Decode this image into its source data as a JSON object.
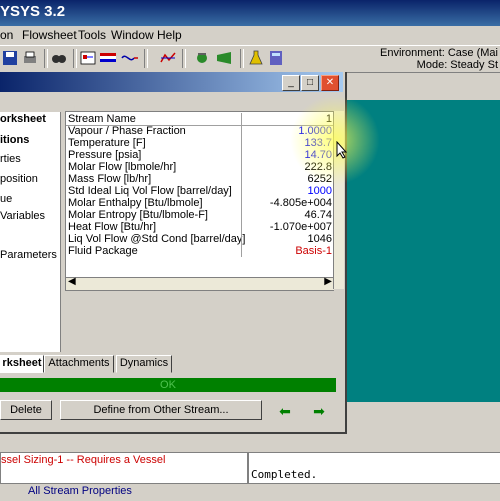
{
  "app": {
    "title": "YSYS 3.2",
    "environment": "Environment: Case (Mai",
    "mode": "Mode: Steady St"
  },
  "menu": [
    "on",
    "Flowsheet",
    "Tools",
    "Window",
    "Help"
  ],
  "toolbar": {
    "icons": [
      "disk-icon",
      "print-icon",
      "binoculars-icon",
      "pfd-icon",
      "workbook-icon",
      "flag-icon",
      "stream-icon",
      "graph-icon",
      "valve-icon",
      "compressor-icon",
      "flask-icon",
      "calculator-icon"
    ]
  },
  "dialog": {
    "nav": [
      {
        "label": "orksheet",
        "bold": true
      },
      {
        "label": "itions",
        "bold": true
      },
      {
        "label": "rties",
        "bold": false
      },
      {
        "label": "position",
        "bold": false
      },
      {
        "label": "ue",
        "bold": false
      },
      {
        "label": "Variables",
        "bold": false
      },
      {
        "label": "Parameters",
        "bold": false
      }
    ],
    "rows": [
      {
        "label": "Stream Name",
        "value": "1",
        "color": "#000000"
      },
      {
        "label": "Vapour / Phase Fraction",
        "value": "1.0000",
        "color": "#0000ff"
      },
      {
        "label": "Temperature [F]",
        "value": "133.7",
        "color": "#0000ff"
      },
      {
        "label": "Pressure [psia]",
        "value": "14.70",
        "color": "#0000ff"
      },
      {
        "label": "Molar Flow [lbmole/hr]",
        "value": "222.8",
        "color": "#000000"
      },
      {
        "label": "Mass Flow [lb/hr]",
        "value": "6252",
        "color": "#000000"
      },
      {
        "label": "Std Ideal Liq Vol Flow [barrel/day]",
        "value": "1000",
        "color": "#0000ff"
      },
      {
        "label": "Molar Enthalpy [Btu/lbmole]",
        "value": "-4.805e+004",
        "color": "#000000"
      },
      {
        "label": "Molar Entropy [Btu/lbmole-F]",
        "value": "46.74",
        "color": "#000000"
      },
      {
        "label": "Heat Flow [Btu/hr]",
        "value": "-1.070e+007",
        "color": "#000000"
      },
      {
        "label": "Liq Vol Flow @Std Cond [barrel/day]",
        "value": "1046",
        "color": "#000000"
      },
      {
        "label": "Fluid Package",
        "value": "Basis-1",
        "color": "#cc0000"
      }
    ],
    "tabs": [
      "rksheet",
      "Attachments",
      "Dynamics"
    ],
    "status": "OK",
    "delete_label": "Delete",
    "define_label": "Define from Other Stream..."
  },
  "bottom": {
    "left_message": "ssel Sizing-1 -- Requires a Vessel",
    "right_message": "Completed.",
    "status_label": "All Stream Properties"
  },
  "colors": {
    "pfd_background": "#008080",
    "ok_bar": "#008000"
  }
}
